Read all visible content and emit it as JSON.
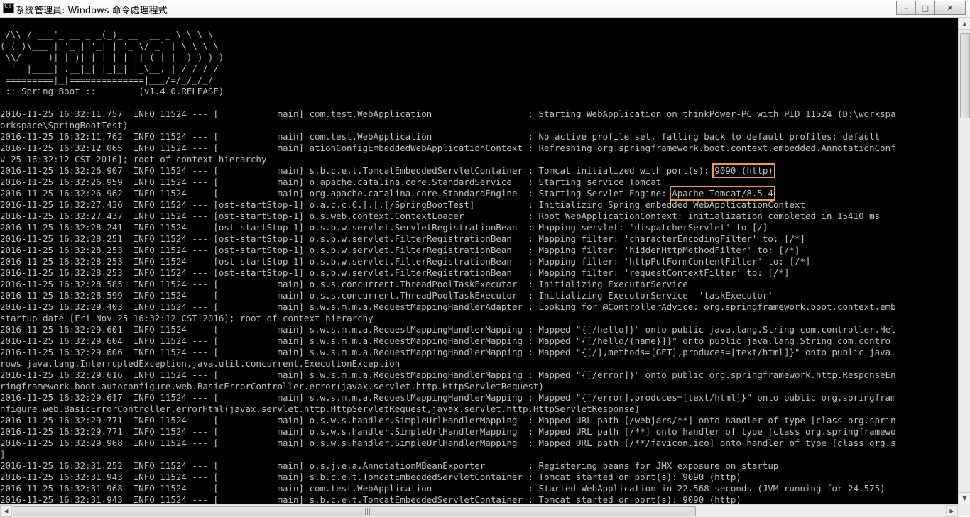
{
  "window": {
    "title": "系統管理員: Windows 命令處理程式",
    "icon": "cmd-icon"
  },
  "controls": {
    "minimize": "–",
    "maximize": "□",
    "close": "✕"
  },
  "console": {
    "lines": [
      "  .   ____          _            __ _ _",
      " /\\\\ / ___'_ __ _ _(_)_ __  __ _ \\ \\ \\ \\",
      "( ( )\\___ | '_ | '_| | '_ \\/ _` | \\ \\ \\ \\",
      " \\\\/  ___)| |_)| | | | | || (_| |  ) ) ) )",
      "  '  |____| .__|_| |_|_| |_\\__, | / / / /",
      " =========|_|==============|___/=/_/_/_/",
      " :: Spring Boot ::        (v1.4.0.RELEASE)",
      "",
      "2016-11-25 16:32:11.757  INFO 11524 --- [           main] com.test.WebApplication                  : Starting WebApplication on thinkPower-PC with PID 11524 (D:\\workspa",
      "orkspace\\SpringBootTest)",
      "2016-11-25 16:32:11.762  INFO 11524 --- [           main] com.test.WebApplication                  : No active profile set, falling back to default profiles: default",
      "2016-11-25 16:32:12.065  INFO 11524 --- [           main] ationConfigEmbeddedWebApplicationContext : Refreshing org.springframework.boot.context.embedded.AnnotationConf",
      "v 25 16:32:12 CST 2016]; root of context hierarchy",
      "2016-11-25 16:32:26.907  INFO 11524 --- [           main] s.b.c.e.t.TomcatEmbeddedServletContainer : Tomcat initialized with port(s): 9090 (http)",
      "2016-11-25 16:32:26.959  INFO 11524 --- [           main] o.apache.catalina.core.StandardService   : Starting service Tomcat",
      "2016-11-25 16:32:26.962  INFO 11524 --- [           main] org.apache.catalina.core.StandardEngine  : Starting Servlet Engine: Apache Tomcat/8.5.4",
      "2016-11-25 16:32:27.436  INFO 11524 --- [ost-startStop-1] o.a.c.c.C.[.[.[/SpringBootTest]          : Initializing Spring embedded WebApplicationContext",
      "2016-11-25 16:32:27.437  INFO 11524 --- [ost-startStop-1] o.s.web.context.ContextLoader            : Root WebApplicationContext: initialization completed in 15410 ms",
      "2016-11-25 16:32:28.241  INFO 11524 --- [ost-startStop-1] o.s.b.w.servlet.ServletRegistrationBean  : Mapping servlet: 'dispatcherServlet' to [/]",
      "2016-11-25 16:32:28.251  INFO 11524 --- [ost-startStop-1] o.s.b.w.servlet.FilterRegistrationBean   : Mapping filter: 'characterEncodingFilter' to: [/*]",
      "2016-11-25 16:32:28.253  INFO 11524 --- [ost-startStop-1] o.s.b.w.servlet.FilterRegistrationBean   : Mapping filter: 'hiddenHttpMethodFilter' to: [/*]",
      "2016-11-25 16:32:28.253  INFO 11524 --- [ost-startStop-1] o.s.b.w.servlet.FilterRegistrationBean   : Mapping filter: 'httpPutFormContentFilter' to: [/*]",
      "2016-11-25 16:32:28.253  INFO 11524 --- [ost-startStop-1] o.s.b.w.servlet.FilterRegistrationBean   : Mapping filter: 'requestContextFilter' to: [/*]",
      "2016-11-25 16:32:28.585  INFO 11524 --- [           main] o.s.s.concurrent.ThreadPoolTaskExecutor  : Initializing ExecutorService",
      "2016-11-25 16:32:28.599  INFO 11524 --- [           main] o.s.s.concurrent.ThreadPoolTaskExecutor  : Initializing ExecutorService  'taskExecutor'",
      "2016-11-25 16:32:29.403  INFO 11524 --- [           main] s.w.s.m.m.a.RequestMappingHandlerAdapter : Looking for @ControllerAdvice: org.springframework.boot.context.emb",
      "startup date [Fri Nov 25 16:32:12 CST 2016]; root of context hierarchy",
      "2016-11-25 16:32:29.601  INFO 11524 --- [           main] s.w.s.m.m.a.RequestMappingHandlerMapping : Mapped \"{[/hello]}\" onto public java.lang.String com.controller.Hel",
      "2016-11-25 16:32:29.604  INFO 11524 --- [           main] s.w.s.m.m.a.RequestMappingHandlerMapping : Mapped \"{[/hello/{name}]}\" onto public java.lang.String com.contro",
      "2016-11-25 16:32:29.606  INFO 11524 --- [           main] s.w.s.m.m.a.RequestMappingHandlerMapping : Mapped \"{[/],methods=[GET],produces=[text/html]}\" onto public java.",
      "rows java.lang.InterruptedException,java.util.concurrent.ExecutionException",
      "2016-11-25 16:32:29.616  INFO 11524 --- [           main] s.w.s.m.m.a.RequestMappingHandlerMapping : Mapped \"{[/error]}\" onto public org.springframework.http.ResponseEn",
      "ringframework.boot.autoconfigure.web.BasicErrorController.error(javax.servlet.http.HttpServletRequest)",
      "2016-11-25 16:32:29.617  INFO 11524 --- [           main] s.w.s.m.m.a.RequestMappingHandlerMapping : Mapped \"{[/error],produces=[text/html]}\" onto public org.springfram",
      "nfigure.web.BasicErrorController.errorHtml(javax.servlet.http.HttpServletRequest,javax.servlet.http.HttpServletResponse)",
      "2016-11-25 16:32:29.771  INFO 11524 --- [           main] o.s.w.s.handler.SimpleUrlHandlerMapping  : Mapped URL path [/webjars/**] onto handler of type [class org.sprin",
      "2016-11-25 16:32:29.771  INFO 11524 --- [           main] o.s.w.s.handler.SimpleUrlHandlerMapping  : Mapped URL path [/**] onto handler of type [class org.springframewo",
      "2016-11-25 16:32:29.968  INFO 11524 --- [           main] o.s.w.s.handler.SimpleUrlHandlerMapping  : Mapped URL path [/**/favicon.ico] onto handler of type [class org.s",
      "]",
      "2016-11-25 16:32:31.252  INFO 11524 --- [           main] o.s.j.e.a.AnnotationMBeanExporter        : Registering beans for JMX exposure on startup",
      "2016-11-25 16:32:31.943  INFO 11524 --- [           main] s.b.c.e.t.TomcatEmbeddedServletContainer : Tomcat started on port(s): 9090 (http)",
      "2016-11-25 16:32:31.968  INFO 11524 --- [           main] com.test.WebApplication                  : Started WebApplication in 22.568 seconds (JVM running for 24.575)",
      "2016-11-25 16:32:31.943  INFO 11524 --- [           main] s.b.c.e.t.TomcatEmbeddedServletContainer : Tomcat started on port(s): 9090 (http)"
    ],
    "highlights": [
      {
        "line": 13,
        "text": "9090 (http)"
      },
      {
        "line": 15,
        "text": "Apache Tomcat/8.5.4"
      }
    ],
    "colors": {
      "background": "#000000",
      "text": "#c0c0c0",
      "highlight": "#f29c38"
    }
  },
  "scrollbars": {
    "up": "▲",
    "down": "▼",
    "left": "◀",
    "right": "▶",
    "grip": "|||"
  }
}
